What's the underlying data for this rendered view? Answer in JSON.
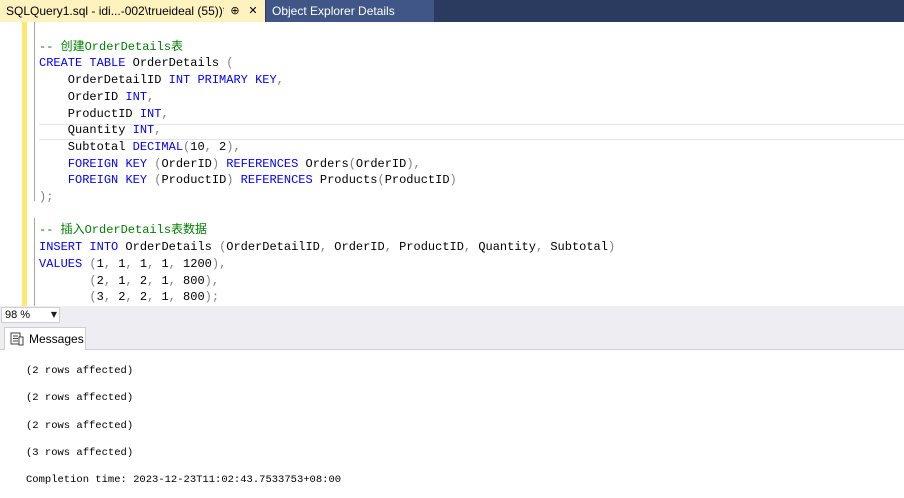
{
  "tabs": [
    {
      "title": "SQLQuery1.sql - idi...-002\\trueideal (55))*",
      "pin": "⊕",
      "close": "✕",
      "active": true
    },
    {
      "title": "Object Explorer Details",
      "pin": "",
      "close": "",
      "active": false
    }
  ],
  "editor": {
    "lines": [
      [],
      [
        [
          "cm",
          "-- 创建OrderDetails表"
        ]
      ],
      [
        [
          "kw",
          "CREATE"
        ],
        [
          "pl",
          " "
        ],
        [
          "kw",
          "TABLE"
        ],
        [
          "pl",
          " OrderDetails "
        ],
        [
          "op",
          "("
        ]
      ],
      [
        [
          "pl",
          "    OrderDetailID "
        ],
        [
          "kw",
          "INT"
        ],
        [
          "pl",
          " "
        ],
        [
          "kw",
          "PRIMARY"
        ],
        [
          "pl",
          " "
        ],
        [
          "kw",
          "KEY"
        ],
        [
          "op",
          ","
        ]
      ],
      [
        [
          "pl",
          "    OrderID "
        ],
        [
          "kw",
          "INT"
        ],
        [
          "op",
          ","
        ]
      ],
      [
        [
          "pl",
          "    ProductID "
        ],
        [
          "kw",
          "INT"
        ],
        [
          "op",
          ","
        ]
      ],
      [
        [
          "pl",
          "    Quantity "
        ],
        [
          "kw",
          "INT"
        ],
        [
          "op",
          ","
        ]
      ],
      [
        [
          "pl",
          "    Subtotal "
        ],
        [
          "kw",
          "DECIMAL"
        ],
        [
          "op",
          "("
        ],
        [
          "pl",
          "10"
        ],
        [
          "op",
          ","
        ],
        [
          "pl",
          " 2"
        ],
        [
          "op",
          "),"
        ]
      ],
      [
        [
          "pl",
          "    "
        ],
        [
          "kw",
          "FOREIGN"
        ],
        [
          "pl",
          " "
        ],
        [
          "kw",
          "KEY"
        ],
        [
          "pl",
          " "
        ],
        [
          "op",
          "("
        ],
        [
          "pl",
          "OrderID"
        ],
        [
          "op",
          ")"
        ],
        [
          "pl",
          " "
        ],
        [
          "kw",
          "REFERENCES"
        ],
        [
          "pl",
          " Orders"
        ],
        [
          "op",
          "("
        ],
        [
          "pl",
          "OrderID"
        ],
        [
          "op",
          "),"
        ]
      ],
      [
        [
          "pl",
          "    "
        ],
        [
          "kw",
          "FOREIGN"
        ],
        [
          "pl",
          " "
        ],
        [
          "kw",
          "KEY"
        ],
        [
          "pl",
          " "
        ],
        [
          "op",
          "("
        ],
        [
          "pl",
          "ProductID"
        ],
        [
          "op",
          ")"
        ],
        [
          "pl",
          " "
        ],
        [
          "kw",
          "REFERENCES"
        ],
        [
          "pl",
          " Products"
        ],
        [
          "op",
          "("
        ],
        [
          "pl",
          "ProductID"
        ],
        [
          "op",
          ")"
        ]
      ],
      [
        [
          "op",
          ");"
        ]
      ],
      [],
      [
        [
          "cm",
          "-- 插入OrderDetails表数据"
        ]
      ],
      [
        [
          "kw",
          "INSERT"
        ],
        [
          "pl",
          " "
        ],
        [
          "kw",
          "INTO"
        ],
        [
          "pl",
          " OrderDetails "
        ],
        [
          "op",
          "("
        ],
        [
          "pl",
          "OrderDetailID"
        ],
        [
          "op",
          ","
        ],
        [
          "pl",
          " OrderID"
        ],
        [
          "op",
          ","
        ],
        [
          "pl",
          " ProductID"
        ],
        [
          "op",
          ","
        ],
        [
          "pl",
          " Quantity"
        ],
        [
          "op",
          ","
        ],
        [
          "pl",
          " Subtotal"
        ],
        [
          "op",
          ")"
        ]
      ],
      [
        [
          "kw",
          "VALUES"
        ],
        [
          "pl",
          " "
        ],
        [
          "op",
          "("
        ],
        [
          "pl",
          "1"
        ],
        [
          "op",
          ","
        ],
        [
          "pl",
          " 1"
        ],
        [
          "op",
          ","
        ],
        [
          "pl",
          " 1"
        ],
        [
          "op",
          ","
        ],
        [
          "pl",
          " 1"
        ],
        [
          "op",
          ","
        ],
        [
          "pl",
          " 1200"
        ],
        [
          "op",
          "),"
        ]
      ],
      [
        [
          "pl",
          "       "
        ],
        [
          "op",
          "("
        ],
        [
          "pl",
          "2"
        ],
        [
          "op",
          ","
        ],
        [
          "pl",
          " 1"
        ],
        [
          "op",
          ","
        ],
        [
          "pl",
          " 2"
        ],
        [
          "op",
          ","
        ],
        [
          "pl",
          " 1"
        ],
        [
          "op",
          ","
        ],
        [
          "pl",
          " 800"
        ],
        [
          "op",
          "),"
        ]
      ],
      [
        [
          "pl",
          "       "
        ],
        [
          "op",
          "("
        ],
        [
          "pl",
          "3"
        ],
        [
          "op",
          ","
        ],
        [
          "pl",
          " 2"
        ],
        [
          "op",
          ","
        ],
        [
          "pl",
          " 2"
        ],
        [
          "op",
          ","
        ],
        [
          "pl",
          " 1"
        ],
        [
          "op",
          ","
        ],
        [
          "pl",
          " 800"
        ],
        [
          "op",
          ");"
        ]
      ]
    ]
  },
  "zoom": {
    "value": "98 %",
    "arrow": "▼"
  },
  "results": {
    "tab_label": "Messages",
    "tab_icon": "messages-icon",
    "messages": [
      "(2 rows affected)",
      "(2 rows affected)",
      "(2 rows affected)",
      "(3 rows affected)",
      "Completion time: 2023-12-23T11:02:43.7533753+08:00"
    ]
  },
  "colors": {
    "keyword": "#0000ff",
    "comment": "#008000",
    "operator": "#808080",
    "active_tab": "#fef3bf",
    "tabstrip": "#2b3a5f",
    "change_bar": "#fbe96d"
  }
}
